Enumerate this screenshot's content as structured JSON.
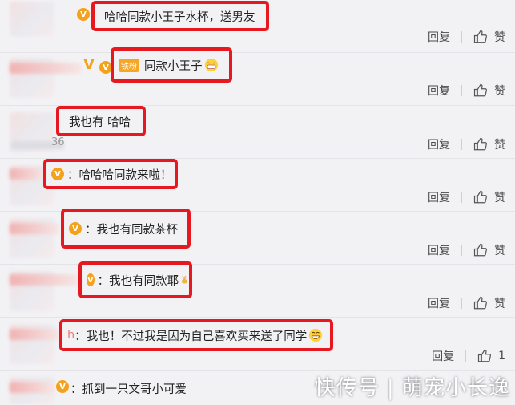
{
  "comments": [
    {
      "text": "哈哈同款小王子水杯，送男友",
      "reply": "回复",
      "like": "赞"
    },
    {
      "badge": "铁粉",
      "text": "同款小王子",
      "reply": "回复",
      "like": "赞"
    },
    {
      "text": "我也有 哈哈",
      "time_tail": "36",
      "reply": "回复",
      "like": "赞"
    },
    {
      "text": "：哈哈哈同款来啦！",
      "reply": "回复",
      "like": "赞"
    },
    {
      "text": "：我也有同款茶杯",
      "reply": "回复",
      "like": "赞"
    },
    {
      "text": "：我也有同款耶",
      "reply": "回复",
      "like": "赞"
    },
    {
      "prefix": "h",
      "text": "：我也！不过我是因为自己喜欢买来送了同学",
      "reply": "回复",
      "like": "1"
    },
    {
      "text": "：抓到一只文哥小可爱"
    }
  ],
  "watermark": "快传号 | 萌宠小长逸"
}
